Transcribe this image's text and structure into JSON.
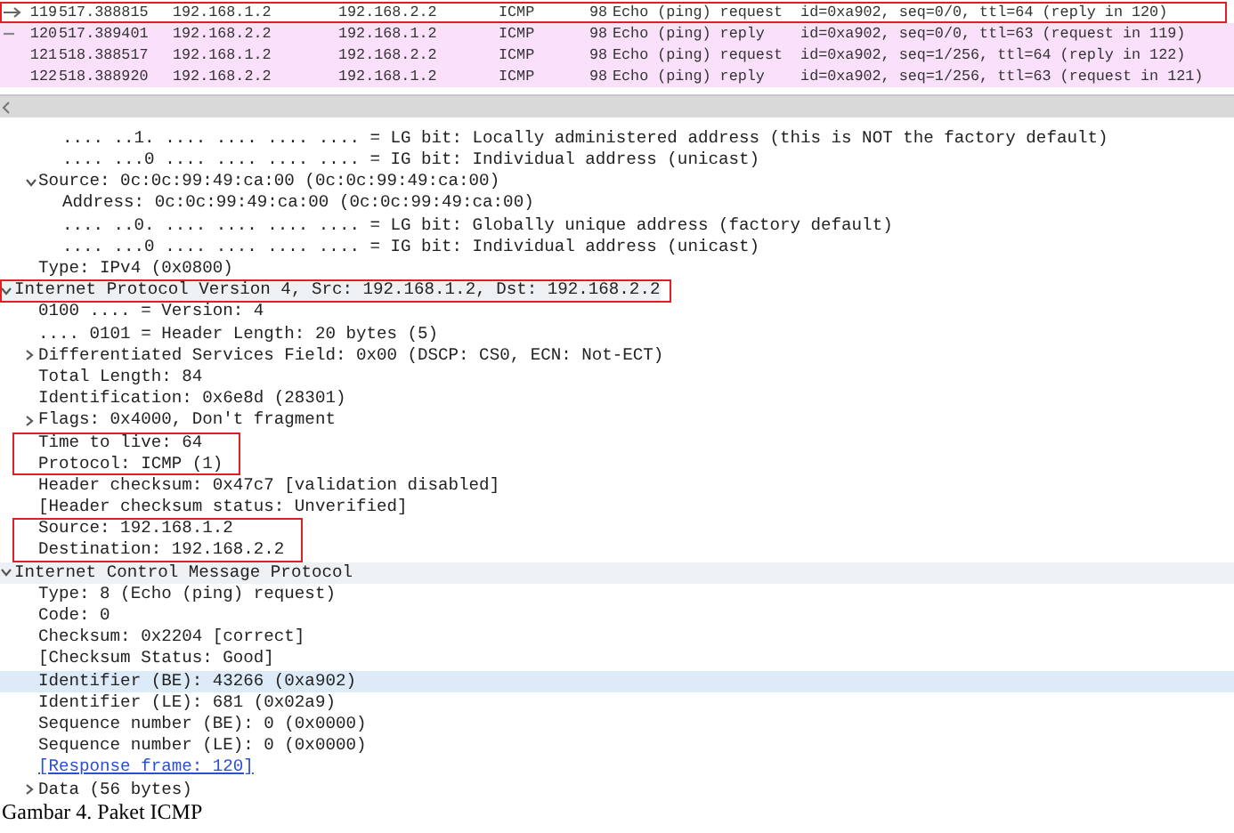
{
  "packet_list": {
    "rows": [
      {
        "no": "119",
        "time": "517.388815",
        "source": "192.168.1.2",
        "destination": "192.168.2.2",
        "protocol": "ICMP",
        "length": "98",
        "info": "Echo (ping) request  id=0xa902, seq=0/0, ttl=64 (reply in 120)",
        "color": "#ffffff",
        "boxed": true,
        "kind": "request"
      },
      {
        "no": "120",
        "time": "517.389401",
        "source": "192.168.2.2",
        "destination": "192.168.1.2",
        "protocol": "ICMP",
        "length": "98",
        "info": "Echo (ping) reply    id=0xa902, seq=0/0, ttl=63 (request in 119)",
        "color": "#fbe0fb",
        "boxed": false,
        "kind": "reply"
      },
      {
        "no": "121",
        "time": "518.388517",
        "source": "192.168.1.2",
        "destination": "192.168.2.2",
        "protocol": "ICMP",
        "length": "98",
        "info": "Echo (ping) request  id=0xa902, seq=1/256, ttl=64 (reply in 122)",
        "color": "#fbe0fb",
        "boxed": false,
        "kind": "plain"
      },
      {
        "no": "122",
        "time": "518.388920",
        "source": "192.168.2.2",
        "destination": "192.168.1.2",
        "protocol": "ICMP",
        "length": "98",
        "info": "Echo (ping) reply    id=0xa902, seq=1/256, ttl=63 (request in 121)",
        "color": "#fbe0fb",
        "boxed": false,
        "kind": "plain"
      }
    ]
  },
  "details": [
    {
      "children": [
        {
          "children": [
            {
              "text": ".... ..1. .... .... .... .... = LG bit: Locally administered address (this is NOT the factory default)"
            },
            {
              "text": ".... ...0 .... .... .... .... = IG bit: Individual address (unicast)"
            }
          ]
        },
        {
          "text": "Source: 0c:0c:99:49:ca:00 (0c:0c:99:49:ca:00)",
          "expanded": true,
          "children": [
            {
              "text": "Address: 0c:0c:99:49:ca:00 (0c:0c:99:49:ca:00)"
            },
            {
              "text": ".... ..0. .... .... .... .... = LG bit: Globally unique address (factory default)"
            },
            {
              "text": ".... ...0 .... .... .... .... = IG bit: Individual address (unicast)"
            }
          ]
        },
        {
          "text": "Type: IPv4 (0x0800)"
        }
      ]
    },
    {
      "text": "Internet Protocol Version 4, Src: 192.168.1.2, Dst: 192.168.2.2",
      "expanded": true,
      "boxed": true,
      "children": [
        {
          "text": "0100 .... = Version: 4"
        },
        {
          "text": ".... 0101 = Header Length: 20 bytes (5)"
        },
        {
          "text": "Differentiated Services Field: 0x00 (DSCP: CS0, ECN: Not-ECT)",
          "expanded": false
        },
        {
          "text": "Total Length: 84"
        },
        {
          "text": "Identification: 0x6e8d (28301)"
        },
        {
          "text": "Flags: 0x4000, Don't fragment",
          "expanded": false
        },
        {
          "text": "Time to live: 64",
          "boxed": true
        },
        {
          "text": "Protocol: ICMP (1)",
          "boxed": true
        },
        {
          "text": "Header checksum: 0x47c7 [validation disabled]"
        },
        {
          "text": "[Header checksum status: Unverified]"
        },
        {
          "text": "Source: 192.168.1.2",
          "boxed": true
        },
        {
          "text": "Destination: 192.168.2.2",
          "boxed": true
        }
      ]
    },
    {
      "text": "Internet Control Message Protocol",
      "expanded": true,
      "children": [
        {
          "text": "Type: 8 (Echo (ping) request)"
        },
        {
          "text": "Code: 0"
        },
        {
          "text": "Checksum: 0x2204 [correct]"
        },
        {
          "text": "[Checksum Status: Good]"
        },
        {
          "text": "Identifier (BE): 43266 (0xa902)",
          "selected": true
        },
        {
          "text": "Identifier (LE): 681 (0x02a9)",
          "selected": false
        },
        {
          "text": "Sequence number (BE): 0 (0x0000)",
          "selected": false
        },
        {
          "text": "Sequence number (LE): 0 (0x0000)",
          "selected": false
        },
        {
          "text": "[Response frame: 120]",
          "kind": "link"
        },
        {
          "text": "Data (56 bytes)",
          "expanded": false
        }
      ]
    }
  ],
  "caption": "Gambar 4. Paket ICMP"
}
